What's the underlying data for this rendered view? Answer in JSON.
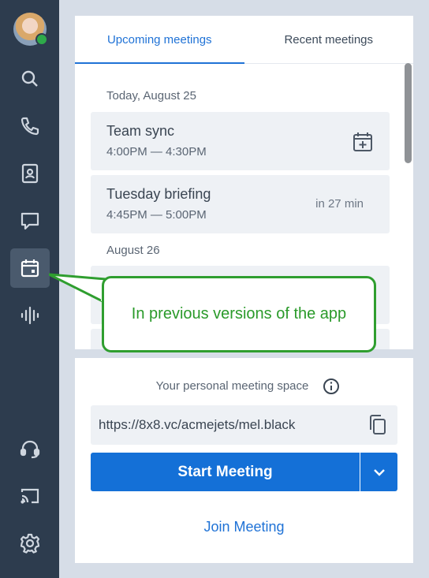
{
  "sidebar": {
    "items": [
      {
        "name": "search-icon"
      },
      {
        "name": "phone-icon"
      },
      {
        "name": "contacts-icon"
      },
      {
        "name": "chat-icon"
      },
      {
        "name": "calendar-icon",
        "active": true
      },
      {
        "name": "voicemail-icon"
      },
      {
        "name": "headset-icon"
      },
      {
        "name": "cast-icon"
      },
      {
        "name": "gear-icon"
      }
    ],
    "presence_color": "#2eaa4a"
  },
  "tabs": [
    {
      "label": "Upcoming meetings",
      "active": true
    },
    {
      "label": "Recent meetings",
      "active": false
    }
  ],
  "meetings": {
    "today_header": "Today, August 25",
    "items": [
      {
        "title": "Team sync",
        "time": "4:00PM — 4:30PM"
      },
      {
        "title": "Tuesday briefing",
        "time": "4:45PM — 5:00PM",
        "countdown": "in 27 min"
      }
    ],
    "next_header": "August 26"
  },
  "personal_space": {
    "label": "Your personal meeting space",
    "link": "https://8x8.vc/acmejets/mel.black"
  },
  "actions": {
    "start": "Start Meeting",
    "join": "Join Meeting"
  },
  "callout": {
    "text": "In previous versions of the app"
  },
  "colors": {
    "accent": "#1470d7",
    "sidebar": "#2d3c4e",
    "callout": "#2f9e2f"
  }
}
